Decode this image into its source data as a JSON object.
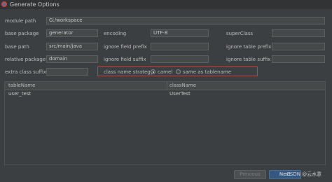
{
  "window": {
    "title": "Generate Options"
  },
  "form": {
    "module_path": {
      "label": "module path",
      "value": "G:/workspace"
    },
    "base_package": {
      "label": "base package",
      "value": "generator"
    },
    "encoding": {
      "label": "encoding",
      "value": "UTF-8"
    },
    "super_class": {
      "label": "superClass",
      "value": ""
    },
    "base_path": {
      "label": "base path",
      "value": "src/main/java"
    },
    "ignore_field_prefix": {
      "label": "ignore field prefix",
      "value": ""
    },
    "ignore_table_prefix": {
      "label": "ignore table prefix",
      "value": ""
    },
    "relative_package": {
      "label": "relative package",
      "value": "domain"
    },
    "ignore_field_suffix": {
      "label": "ignore field suffix",
      "value": ""
    },
    "ignore_table_suffix": {
      "label": "ignore table suffix",
      "value": ""
    },
    "extra_class_suffix": {
      "label": "extra class suffix",
      "value": ""
    }
  },
  "strategy": {
    "label": "class name strategy",
    "options": [
      "camel",
      "same as tablename"
    ],
    "selected": "camel"
  },
  "table": {
    "columns": [
      "tableName",
      "className"
    ],
    "rows": [
      [
        "user_test",
        "UserTest"
      ]
    ]
  },
  "buttons": {
    "previous": "Previous",
    "next": "Next"
  },
  "watermark": "CSDN @云水意"
}
